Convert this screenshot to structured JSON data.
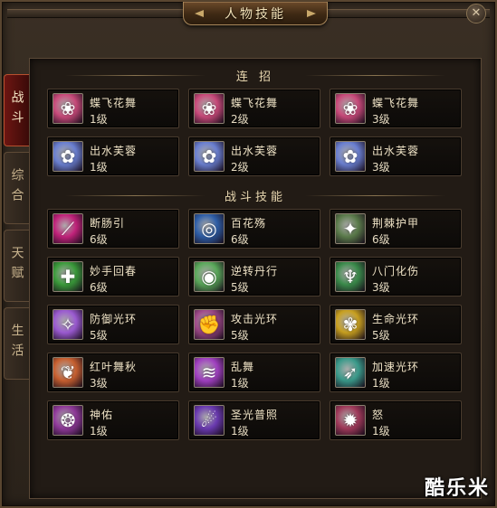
{
  "window": {
    "title": "人物技能",
    "close_label": "✕"
  },
  "tabs": [
    {
      "label": "战斗",
      "active": true
    },
    {
      "label": "综合",
      "active": false
    },
    {
      "label": "天赋",
      "active": false
    },
    {
      "label": "生活",
      "active": false
    }
  ],
  "sections": [
    {
      "title": "连 招",
      "rows": [
        [
          {
            "name": "蝶飞花舞",
            "level": "1级",
            "icon": "butterfly-icon",
            "color": "#c84a7a"
          },
          {
            "name": "蝶飞花舞",
            "level": "2级",
            "icon": "butterfly-icon",
            "color": "#c84a7a"
          },
          {
            "name": "蝶飞花舞",
            "level": "3级",
            "icon": "butterfly-icon",
            "color": "#c84a7a"
          }
        ],
        [
          {
            "name": "出水芙蓉",
            "level": "1级",
            "icon": "lotus-icon",
            "color": "#6a7fd0"
          },
          {
            "name": "出水芙蓉",
            "level": "2级",
            "icon": "lotus-icon",
            "color": "#6a7fd0"
          },
          {
            "name": "出水芙蓉",
            "level": "3级",
            "icon": "lotus-icon",
            "color": "#6a7fd0"
          }
        ]
      ]
    },
    {
      "title": "战斗技能",
      "rows": [
        [
          {
            "name": "断肠引",
            "level": "6级",
            "icon": "slash-icon",
            "color": "#c0227a"
          },
          {
            "name": "百花殇",
            "level": "6级",
            "icon": "swirl-icon",
            "color": "#2f5fa8"
          },
          {
            "name": "荆棘护甲",
            "level": "6级",
            "icon": "thorn-icon",
            "color": "#5a7a4a"
          }
        ],
        [
          {
            "name": "妙手回春",
            "level": "6级",
            "icon": "heal-icon",
            "color": "#3a9a3a"
          },
          {
            "name": "逆转丹行",
            "level": "5级",
            "icon": "orb-icon",
            "color": "#5aa85a"
          },
          {
            "name": "八门化伤",
            "level": "3级",
            "icon": "figure-icon",
            "color": "#3a8a4a"
          }
        ],
        [
          {
            "name": "防御光环",
            "level": "5级",
            "icon": "shield-aura-icon",
            "color": "#9a5ad0"
          },
          {
            "name": "攻击光环",
            "level": "5级",
            "icon": "fist-icon",
            "color": "#a04a8a"
          },
          {
            "name": "生命光环",
            "level": "5级",
            "icon": "flower-aura-icon",
            "color": "#c8a020"
          }
        ],
        [
          {
            "name": "红叶舞秋",
            "level": "3级",
            "icon": "leaf-icon",
            "color": "#c86030"
          },
          {
            "name": "乱舞",
            "level": "1级",
            "icon": "dance-icon",
            "color": "#a040c0"
          },
          {
            "name": "加速光环",
            "level": "1级",
            "icon": "speed-aura-icon",
            "color": "#3a9a8a"
          }
        ],
        [
          {
            "name": "神佑",
            "level": "1级",
            "icon": "blessing-icon",
            "color": "#903a9a"
          },
          {
            "name": "圣光普照",
            "level": "1级",
            "icon": "holy-light-icon",
            "color": "#6a3ab0"
          },
          {
            "name": "怒",
            "level": "1级",
            "icon": "rage-icon",
            "color": "#a03a5a"
          }
        ]
      ]
    }
  ],
  "watermark": "酷乐米"
}
